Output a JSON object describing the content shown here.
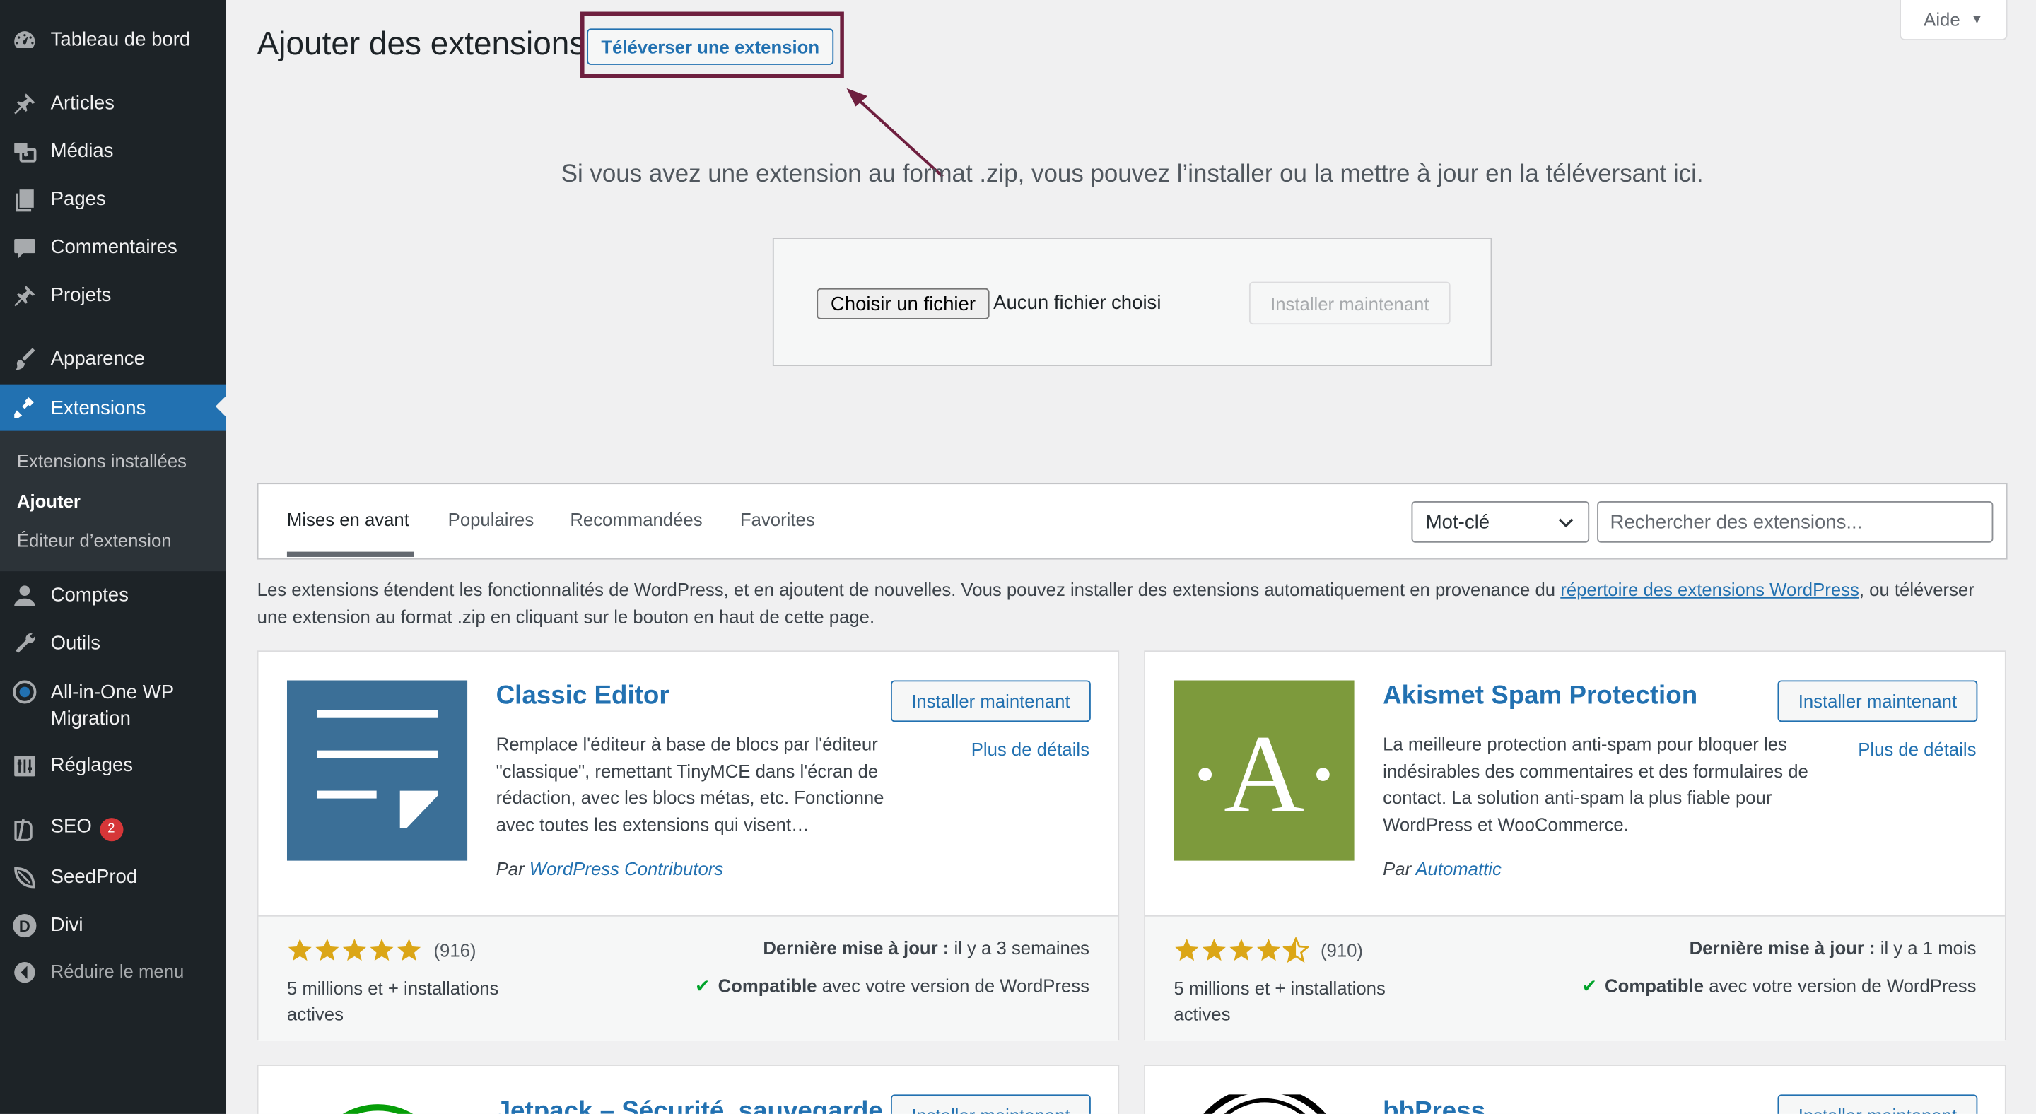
{
  "sidebar": {
    "dashboard": "Tableau de bord",
    "articles": "Articles",
    "medias": "Médias",
    "pages": "Pages",
    "comments": "Commentaires",
    "projects": "Projets",
    "appearance": "Apparence",
    "extensions": "Extensions",
    "sub_installed": "Extensions installées",
    "sub_add": "Ajouter",
    "sub_editor": "Éditeur d’extension",
    "accounts": "Comptes",
    "tools": "Outils",
    "migration_line1": "All-in-One WP",
    "migration_line2": "Migration",
    "settings": "Réglages",
    "seo": "SEO",
    "seo_badge": "2",
    "seedprod": "SeedProd",
    "divi": "Divi",
    "collapse": "Réduire le menu"
  },
  "header": {
    "title": "Ajouter des extensions",
    "upload_button": "Téléverser une extension",
    "help": "Aide"
  },
  "upload": {
    "message": "Si vous avez une extension au format .zip, vous pouvez l’installer ou la mettre à jour en la téléversant ici.",
    "choose_file": "Choisir un fichier",
    "no_file": "Aucun fichier choisi",
    "install_now": "Installer maintenant"
  },
  "filters": {
    "tabs": [
      "Mises en avant",
      "Populaires",
      "Recommandées",
      "Favorites"
    ],
    "keyword": "Mot-clé",
    "search_placeholder": "Rechercher des extensions..."
  },
  "intro": {
    "text_before": "Les extensions étendent les fonctionnalités de WordPress, et en ajoutent de nouvelles. Vous pouvez installer des extensions automatiquement en provenance du ",
    "link": "répertoire des extensions WordPress",
    "text_after": ", ou téléverser une extension au format .zip en cliquant sur le bouton en haut de cette page."
  },
  "plugins": [
    {
      "name": "Classic Editor",
      "install": "Installer maintenant",
      "details": "Plus de détails",
      "description": "Remplace l'éditeur à base de blocs par l'éditeur \"classique\", remettant TinyMCE dans l'écran de rédaction, avec les blocs métas, etc. Fonctionne avec toutes les extensions qui visent…",
      "author_prefix": "Par",
      "author": "WordPress Contributors",
      "rating": 5,
      "rating_count": "(916)",
      "installs": "5 millions et + installations actives",
      "updated_label": "Dernière mise à jour :",
      "updated": "il y a 3 semaines",
      "compat_strong": "Compatible",
      "compat_rest": "avec votre version de WordPress",
      "icon": "document-lines-icon",
      "color": "#3b6f97"
    },
    {
      "name": "Akismet Spam Protection",
      "install": "Installer maintenant",
      "details": "Plus de détails",
      "description": "La meilleure protection anti-spam pour bloquer les indésirables des commentaires et des formulaires de contact. La solution anti-spam la plus fiable pour WordPress et WooCommerce.",
      "author_prefix": "Par",
      "author": "Automattic",
      "rating": 4.5,
      "rating_count": "(910)",
      "installs": "5 millions et + installations actives",
      "updated_label": "Dernière mise à jour :",
      "updated": "il y a 1 mois",
      "compat_strong": "Compatible",
      "compat_rest": "avec votre version de WordPress",
      "icon": "akismet-logo",
      "logo_letter": "·A·",
      "color": "#7d9a3c"
    },
    {
      "name": "Jetpack – Sécurité, sauvegarde",
      "install": "Installer maintenant"
    },
    {
      "name": "bbPress",
      "install": "Installer maintenant"
    }
  ],
  "colors": {
    "sidebar": "#1d2327",
    "accent": "#2271b1",
    "highlight": "#6e1f3f",
    "star": "#dba617"
  }
}
